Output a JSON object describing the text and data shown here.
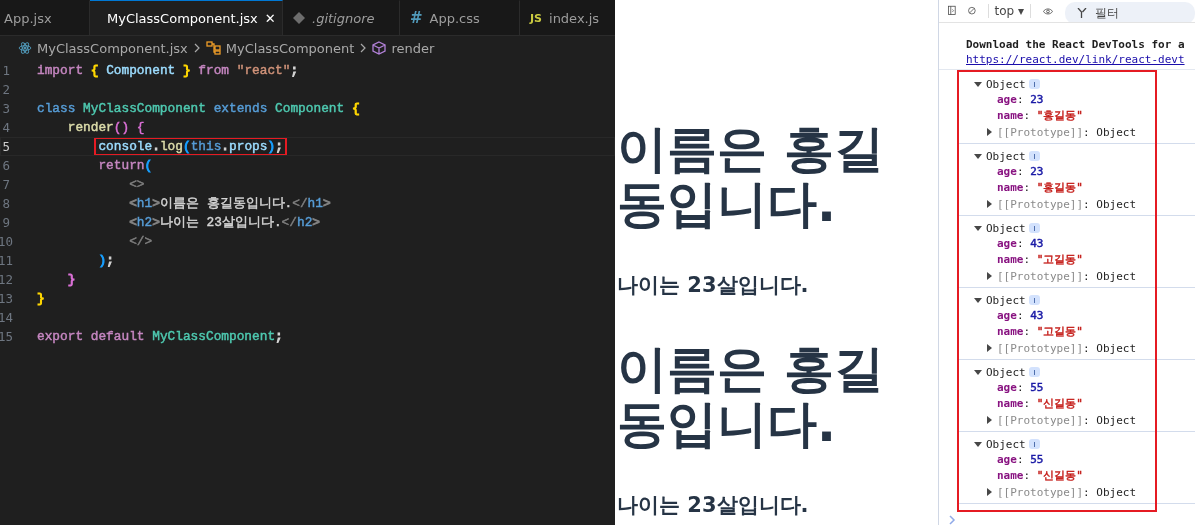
{
  "editor": {
    "tabs": [
      {
        "label": "App.jsx",
        "selected": false,
        "italic": false
      },
      {
        "label": "MyClassComponent.jsx",
        "kind": "react",
        "selected": true,
        "italic": false,
        "close": "✕"
      },
      {
        "label": ".gitignore",
        "kind": "git",
        "selected": false,
        "italic": true
      },
      {
        "label": "App.css",
        "kind": "css",
        "glyph": "#",
        "selected": false,
        "italic": false
      },
      {
        "label": "index.js",
        "kind": "js",
        "glyph": "JS",
        "selected": false,
        "italic": false
      }
    ],
    "breadcrumbs": [
      {
        "label": "MyClassComponent.jsx",
        "kind": "react"
      },
      {
        "label": "MyClassComponent",
        "kind": "class"
      },
      {
        "label": "render",
        "kind": "method"
      }
    ],
    "lines": [
      {
        "number": "1",
        "current": false,
        "boxed": false,
        "tokens": [
          {
            "t": "import ",
            "color": "#c586c0"
          },
          {
            "t": "{",
            "color": "#ffd700"
          },
          {
            "t": " Component ",
            "color": "#9cdcfe"
          },
          {
            "t": "}",
            "color": "#ffd700"
          },
          {
            "t": " from ",
            "color": "#c586c0"
          },
          {
            "t": "\"react\"",
            "color": "#ce9178"
          },
          {
            "t": ";",
            "color": "#d4d4d4"
          }
        ]
      },
      {
        "number": "2",
        "current": false,
        "boxed": false
      },
      {
        "number": "3",
        "current": false,
        "boxed": false,
        "tokens": [
          {
            "t": "class ",
            "color": "#569cd6"
          },
          {
            "t": "MyClassComponent ",
            "color": "#4ec9b0"
          },
          {
            "t": "extends ",
            "color": "#569cd6"
          },
          {
            "t": "Component ",
            "color": "#4ec9b0"
          },
          {
            "t": "{",
            "color": "#ffd700"
          }
        ]
      },
      {
        "number": "4",
        "current": false,
        "boxed": false,
        "tokens": [
          {
            "t": "    render",
            "color": "#dcdcaa"
          },
          {
            "t": "() {",
            "color": "#da70d6"
          }
        ]
      },
      {
        "number": "5",
        "current": true,
        "boxed": true,
        "tokens": [
          {
            "t": "        console",
            "color": "#9cdcfe"
          },
          {
            "t": ".",
            "color": "#d4d4d4"
          },
          {
            "t": "log",
            "color": "#dcdcaa"
          },
          {
            "t": "(",
            "color": "#179fff"
          },
          {
            "t": "this",
            "color": "#569cd6"
          },
          {
            "t": ".",
            "color": "#d4d4d4"
          },
          {
            "t": "props",
            "color": "#9cdcfe"
          },
          {
            "t": ")",
            "color": "#179fff"
          },
          {
            "t": ";",
            "color": "#d4d4d4"
          }
        ]
      },
      {
        "number": "6",
        "current": false,
        "boxed": false,
        "tokens": [
          {
            "t": "        return",
            "color": "#c586c0"
          },
          {
            "t": "(",
            "color": "#179fff"
          }
        ]
      },
      {
        "number": "7",
        "current": false,
        "boxed": false,
        "tokens": [
          {
            "t": "            <>",
            "color": "#808080"
          }
        ]
      },
      {
        "number": "8",
        "current": false,
        "boxed": false,
        "tokens": [
          {
            "t": "            <",
            "color": "#808080"
          },
          {
            "t": "h1",
            "color": "#569cd6"
          },
          {
            "t": ">",
            "color": "#808080"
          },
          {
            "t": "이름은 홍길동입니다.",
            "color": "#d4d4d4"
          },
          {
            "t": "</",
            "color": "#808080"
          },
          {
            "t": "h1",
            "color": "#569cd6"
          },
          {
            "t": ">",
            "color": "#808080"
          }
        ]
      },
      {
        "number": "9",
        "current": false,
        "boxed": false,
        "tokens": [
          {
            "t": "            <",
            "color": "#808080"
          },
          {
            "t": "h2",
            "color": "#569cd6"
          },
          {
            "t": ">",
            "color": "#808080"
          },
          {
            "t": "나이는 23살입니다.",
            "color": "#d4d4d4"
          },
          {
            "t": "</",
            "color": "#808080"
          },
          {
            "t": "h2",
            "color": "#569cd6"
          },
          {
            "t": ">",
            "color": "#808080"
          }
        ]
      },
      {
        "number": "10",
        "current": false,
        "boxed": false,
        "tokens": [
          {
            "t": "            </>",
            "color": "#808080"
          }
        ]
      },
      {
        "number": "11",
        "current": false,
        "boxed": false,
        "tokens": [
          {
            "t": "        )",
            "color": "#179fff"
          },
          {
            "t": ";",
            "color": "#d4d4d4"
          }
        ]
      },
      {
        "number": "12",
        "current": false,
        "boxed": false,
        "tokens": [
          {
            "t": "    }",
            "color": "#da70d6"
          }
        ]
      },
      {
        "number": "13",
        "current": false,
        "boxed": false,
        "tokens": [
          {
            "t": "}",
            "color": "#ffd700"
          }
        ]
      },
      {
        "number": "14",
        "current": false,
        "boxed": false
      },
      {
        "number": "15",
        "current": false,
        "boxed": false,
        "tokens": [
          {
            "t": "export default ",
            "color": "#c586c0"
          },
          {
            "t": "MyClassComponent",
            "color": "#4ec9b0"
          },
          {
            "t": ";",
            "color": "#d4d4d4"
          }
        ]
      }
    ]
  },
  "preview": {
    "blocks": [
      {
        "kind": "h1",
        "text": "이름은 홍길동입니다."
      },
      {
        "kind": "h2",
        "text": "나이는 23살입니다."
      },
      {
        "kind": "h1",
        "text": "이름은 홍길동입니다."
      },
      {
        "kind": "h2",
        "text": "나이는 23살입니다."
      }
    ]
  },
  "console": {
    "context": "top",
    "context_caret": "▾",
    "filter": {
      "placeholder": "필터"
    },
    "message": "Download the React DevTools for a",
    "link": "https://react.dev/link/react-devt",
    "highlight_box": true,
    "entries": [
      {
        "label": "Object",
        "expanded": true,
        "props": [
          {
            "key": "age",
            "colon": ":",
            "value": "23",
            "color": "#1a1aa6"
          },
          {
            "key": "name",
            "colon": ":",
            "value": "\"홍길동\"",
            "color": "#c41a16"
          }
        ],
        "proto": {
          "key": "[[Prototype]]",
          "colon": ":",
          "value": "Object",
          "expanded": false
        }
      },
      {
        "label": "Object",
        "expanded": true,
        "props": [
          {
            "key": "age",
            "colon": ":",
            "value": "23",
            "color": "#1a1aa6"
          },
          {
            "key": "name",
            "colon": ":",
            "value": "\"홍길동\"",
            "color": "#c41a16"
          }
        ],
        "proto": {
          "key": "[[Prototype]]",
          "colon": ":",
          "value": "Object",
          "expanded": false
        }
      },
      {
        "label": "Object",
        "expanded": true,
        "props": [
          {
            "key": "age",
            "colon": ":",
            "value": "43",
            "color": "#1a1aa6"
          },
          {
            "key": "name",
            "colon": ":",
            "value": "\"고길동\"",
            "color": "#c41a16"
          }
        ],
        "proto": {
          "key": "[[Prototype]]",
          "colon": ":",
          "value": "Object",
          "expanded": false
        }
      },
      {
        "label": "Object",
        "expanded": true,
        "props": [
          {
            "key": "age",
            "colon": ":",
            "value": "43",
            "color": "#1a1aa6"
          },
          {
            "key": "name",
            "colon": ":",
            "value": "\"고길동\"",
            "color": "#c41a16"
          }
        ],
        "proto": {
          "key": "[[Prototype]]",
          "colon": ":",
          "value": "Object",
          "expanded": false
        }
      },
      {
        "label": "Object",
        "expanded": true,
        "props": [
          {
            "key": "age",
            "colon": ":",
            "value": "55",
            "color": "#1a1aa6"
          },
          {
            "key": "name",
            "colon": ":",
            "value": "\"신길동\"",
            "color": "#c41a16"
          }
        ],
        "proto": {
          "key": "[[Prototype]]",
          "colon": ":",
          "value": "Object",
          "expanded": false
        }
      },
      {
        "label": "Object",
        "expanded": true,
        "props": [
          {
            "key": "age",
            "colon": ":",
            "value": "55",
            "color": "#1a1aa6"
          },
          {
            "key": "name",
            "colon": ":",
            "value": "\"신길동\"",
            "color": "#c41a16"
          }
        ],
        "proto": {
          "key": "[[Prototype]]",
          "colon": ":",
          "value": "Object",
          "expanded": false
        }
      }
    ]
  }
}
